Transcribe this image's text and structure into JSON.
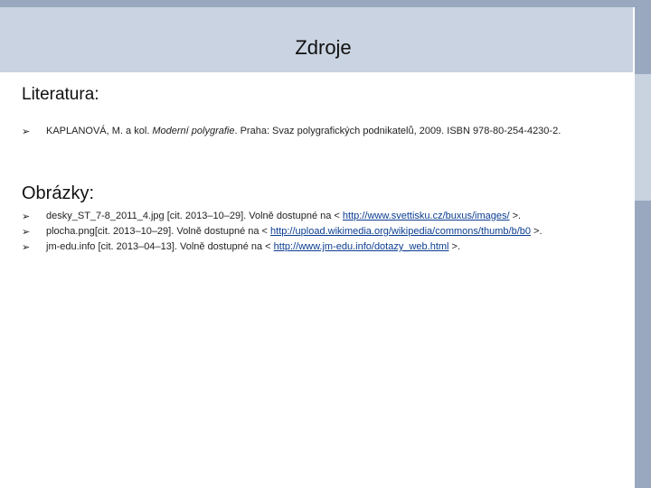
{
  "title": "Zdroje",
  "literatura": {
    "heading": "Literatura:",
    "items": [
      {
        "author": "KAPLANOVÁ, M. a kol. ",
        "work": "Moderní polygrafie",
        "rest": ". Praha: Svaz polygrafických podnikatelů, 2009. ISBN 978-80-254-4230-2."
      }
    ]
  },
  "obrazky": {
    "heading": "Obrázky:",
    "items": [
      {
        "prefix": "desky_ST_7-8_2011_4.jpg [cit. 2013–10–29]. Volně dostupné na < ",
        "link": "http://www.svettisku.cz/buxus/images/",
        "suffix": " >."
      },
      {
        "prefix": "plocha.png[cit. 2013–10–29]. Volně dostupné na < ",
        "link": "http://upload.wikimedia.org/wikipedia/commons/thumb/b/b0",
        "suffix": " >."
      },
      {
        "prefix": "jm-edu.info [cit. 2013–04–13]. Volně dostupné na < ",
        "link": "http://www.jm-edu.info/dotazy_web.html",
        "suffix": " >."
      }
    ]
  },
  "icons": {
    "bullet": "arrowhead-bullet-icon",
    "bullet_glyph": "➢"
  },
  "colors": {
    "title_band": "#c9d3e1",
    "frame": "#9aa8bf",
    "link": "#0b3d91"
  }
}
